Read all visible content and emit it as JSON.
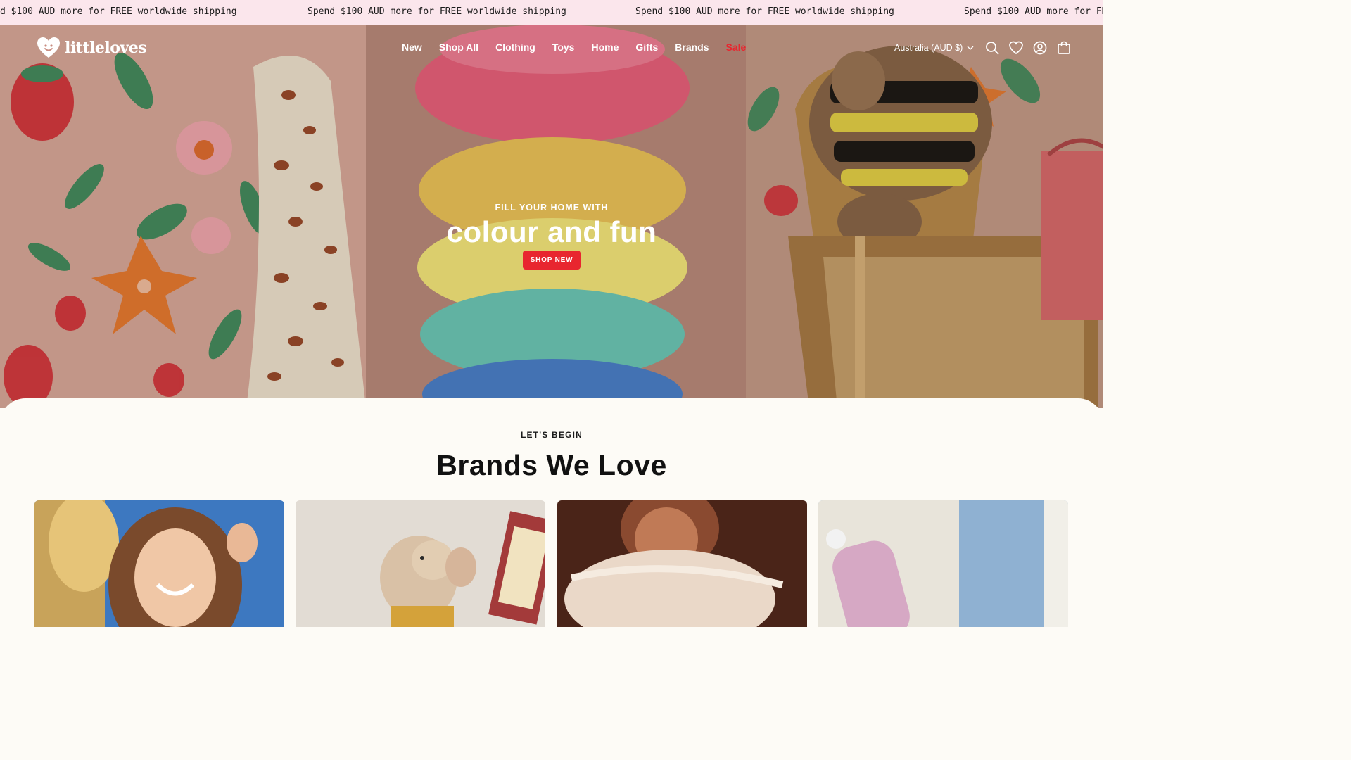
{
  "announcement": {
    "messages": [
      "d $100 AUD more for FREE worldwide shipping",
      "Spend $100 AUD more for FREE worldwide shipping",
      "Spend $100 AUD more for FREE worldwide shipping",
      "Spend $100 AUD more for FRE"
    ]
  },
  "header": {
    "logo_text": "littleloves",
    "nav": [
      {
        "label": "New"
      },
      {
        "label": "Shop All"
      },
      {
        "label": "Clothing"
      },
      {
        "label": "Toys"
      },
      {
        "label": "Home"
      },
      {
        "label": "Gifts"
      },
      {
        "label": "Brands"
      },
      {
        "label": "Sale"
      }
    ],
    "country_selector": "Australia (AUD $)",
    "icons": [
      "search-icon",
      "wishlist-heart-icon",
      "account-icon",
      "cart-bag-icon"
    ]
  },
  "hero": {
    "eyebrow": "FILL YOUR HOME WITH",
    "headline": "colour and fun",
    "cta": "SHOP NEW"
  },
  "brands_section": {
    "eyebrow": "LET'S BEGIN",
    "title": "Brands We Love",
    "cards": [
      {
        "image": "girl-smiling-photo"
      },
      {
        "image": "plush-mouse-photo"
      },
      {
        "image": "child-tutu-photo"
      },
      {
        "image": "kid-skateboard-photo"
      }
    ]
  },
  "colors": {
    "announcement_bg": "#fbe6ec",
    "sale_red": "#e8262f",
    "cta_red": "#e8262f",
    "page_bg": "#fdfbf6"
  }
}
